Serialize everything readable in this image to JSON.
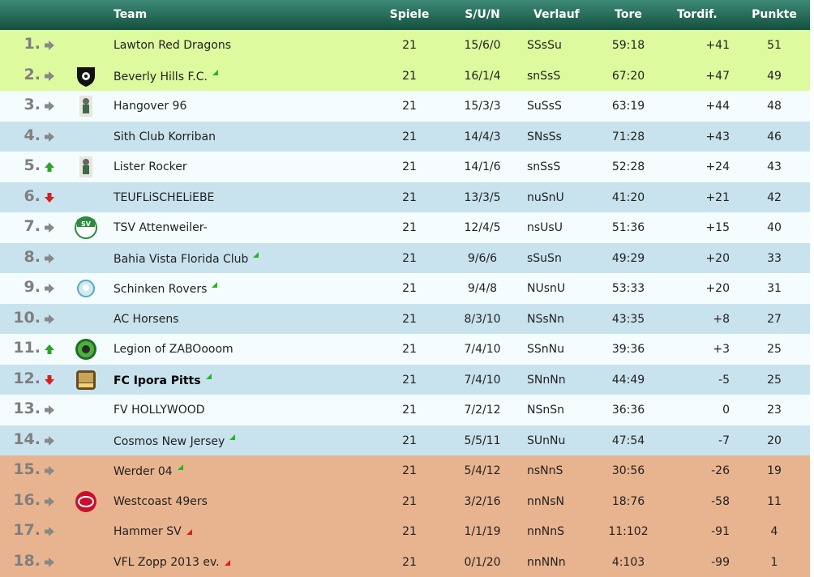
{
  "header": {
    "team": "Team",
    "spiele": "Spiele",
    "sun": "S/U/N",
    "verlauf": "Verlauf",
    "tore": "Tore",
    "tordif": "Tordif.",
    "punkte": "Punkte"
  },
  "colors": {
    "promotion": "#ddfa9e",
    "neutral_light": "#f4fcfe",
    "neutral_blue": "#c9e3ee",
    "relegation": "#e8b48f",
    "arrow_up": "#2aa52a",
    "arrow_down": "#d62020",
    "arrow_same": "#888888"
  },
  "rows": [
    {
      "rank": "1.",
      "trend": "same",
      "logo": "",
      "team": "Lawton Red Dragons",
      "flag": "",
      "spiele": "21",
      "sun": "15/6/0",
      "verlauf": "SSsSu",
      "tore": "59:18",
      "tordif": "+41",
      "punkte": "51",
      "zone": "promotion",
      "bold": false
    },
    {
      "rank": "2.",
      "trend": "same",
      "logo": "shield-logo",
      "team": "Beverly Hills F.C.",
      "flag": "green",
      "spiele": "21",
      "sun": "16/1/4",
      "verlauf": "snSsS",
      "tore": "67:20",
      "tordif": "+47",
      "punkte": "49",
      "zone": "promotion",
      "bold": false
    },
    {
      "rank": "3.",
      "trend": "same",
      "logo": "figure-logo",
      "team": "Hangover 96",
      "flag": "",
      "spiele": "21",
      "sun": "15/3/3",
      "verlauf": "SuSsS",
      "tore": "63:19",
      "tordif": "+44",
      "punkte": "48",
      "zone": "light",
      "bold": false
    },
    {
      "rank": "4.",
      "trend": "same",
      "logo": "",
      "team": "Sith Club Korriban",
      "flag": "",
      "spiele": "21",
      "sun": "14/4/3",
      "verlauf": "SNsSs",
      "tore": "71:28",
      "tordif": "+43",
      "punkte": "46",
      "zone": "blue",
      "bold": false
    },
    {
      "rank": "5.",
      "trend": "up",
      "logo": "figure-logo",
      "team": "Lister Rocker",
      "flag": "",
      "spiele": "21",
      "sun": "14/1/6",
      "verlauf": "snSsS",
      "tore": "52:28",
      "tordif": "+24",
      "punkte": "43",
      "zone": "light",
      "bold": false
    },
    {
      "rank": "6.",
      "trend": "down",
      "logo": "",
      "team": "TEUFLiSCHELiEBE",
      "flag": "",
      "spiele": "21",
      "sun": "13/3/5",
      "verlauf": "nuSnU",
      "tore": "41:20",
      "tordif": "+21",
      "punkte": "42",
      "zone": "blue",
      "bold": false
    },
    {
      "rank": "7.",
      "trend": "same",
      "logo": "sv-logo",
      "team": "TSV Attenweiler-",
      "flag": "",
      "spiele": "21",
      "sun": "12/4/5",
      "verlauf": "nsUsU",
      "tore": "51:36",
      "tordif": "+15",
      "punkte": "40",
      "zone": "light",
      "bold": false
    },
    {
      "rank": "8.",
      "trend": "same",
      "logo": "",
      "team": "Bahia Vista Florida Club",
      "flag": "green",
      "spiele": "21",
      "sun": "9/6/6",
      "verlauf": "sSuSn",
      "tore": "49:29",
      "tordif": "+20",
      "punkte": "33",
      "zone": "blue",
      "bold": false
    },
    {
      "rank": "9.",
      "trend": "same",
      "logo": "ball-logo",
      "team": "Schinken Rovers",
      "flag": "green",
      "spiele": "21",
      "sun": "9/4/8",
      "verlauf": "NUsnU",
      "tore": "53:33",
      "tordif": "+20",
      "punkte": "31",
      "zone": "light",
      "bold": false
    },
    {
      "rank": "10.",
      "trend": "same",
      "logo": "",
      "team": "AC Horsens",
      "flag": "",
      "spiele": "21",
      "sun": "8/3/10",
      "verlauf": "NSsNn",
      "tore": "43:35",
      "tordif": "+8",
      "punkte": "27",
      "zone": "blue",
      "bold": false
    },
    {
      "rank": "11.",
      "trend": "up",
      "logo": "green-badge-logo",
      "team": "Legion of ZABOooom",
      "flag": "",
      "spiele": "21",
      "sun": "7/4/10",
      "verlauf": "SSnNu",
      "tore": "39:36",
      "tordif": "+3",
      "punkte": "25",
      "zone": "light",
      "bold": false
    },
    {
      "rank": "12.",
      "trend": "down",
      "logo": "crest-logo",
      "team": "FC Ipora Pitts",
      "flag": "green",
      "spiele": "21",
      "sun": "7/4/10",
      "verlauf": "SNnNn",
      "tore": "44:49",
      "tordif": "-5",
      "punkte": "25",
      "zone": "blue",
      "bold": true
    },
    {
      "rank": "13.",
      "trend": "same",
      "logo": "",
      "team": "FV HOLLYWOOD",
      "flag": "",
      "spiele": "21",
      "sun": "7/2/12",
      "verlauf": "NSnSn",
      "tore": "36:36",
      "tordif": "0",
      "punkte": "23",
      "zone": "light",
      "bold": false
    },
    {
      "rank": "14.",
      "trend": "same",
      "logo": "",
      "team": "Cosmos New Jersey",
      "flag": "green",
      "spiele": "21",
      "sun": "5/5/11",
      "verlauf": "SUnNu",
      "tore": "47:54",
      "tordif": "-7",
      "punkte": "20",
      "zone": "blue",
      "bold": false
    },
    {
      "rank": "15.",
      "trend": "same",
      "logo": "",
      "team": "Werder 04",
      "flag": "green",
      "spiele": "21",
      "sun": "5/4/12",
      "verlauf": "nsNnS",
      "tore": "30:56",
      "tordif": "-26",
      "punkte": "19",
      "zone": "relegation",
      "bold": false
    },
    {
      "rank": "16.",
      "trend": "same",
      "logo": "49ers-logo",
      "team": "Westcoast 49ers",
      "flag": "",
      "spiele": "21",
      "sun": "3/2/16",
      "verlauf": "nnNsN",
      "tore": "18:76",
      "tordif": "-58",
      "punkte": "11",
      "zone": "relegation",
      "bold": false
    },
    {
      "rank": "17.",
      "trend": "same",
      "logo": "",
      "team": "Hammer SV",
      "flag": "red",
      "spiele": "21",
      "sun": "1/1/19",
      "verlauf": "nnNnS",
      "tore": "11:102",
      "tordif": "-91",
      "punkte": "4",
      "zone": "relegation",
      "bold": false
    },
    {
      "rank": "18.",
      "trend": "same",
      "logo": "",
      "team": "VFL Zopp 2013 ev.",
      "flag": "red",
      "spiele": "21",
      "sun": "0/1/20",
      "verlauf": "nnNNn",
      "tore": "4:103",
      "tordif": "-99",
      "punkte": "1",
      "zone": "relegation",
      "bold": false
    }
  ]
}
